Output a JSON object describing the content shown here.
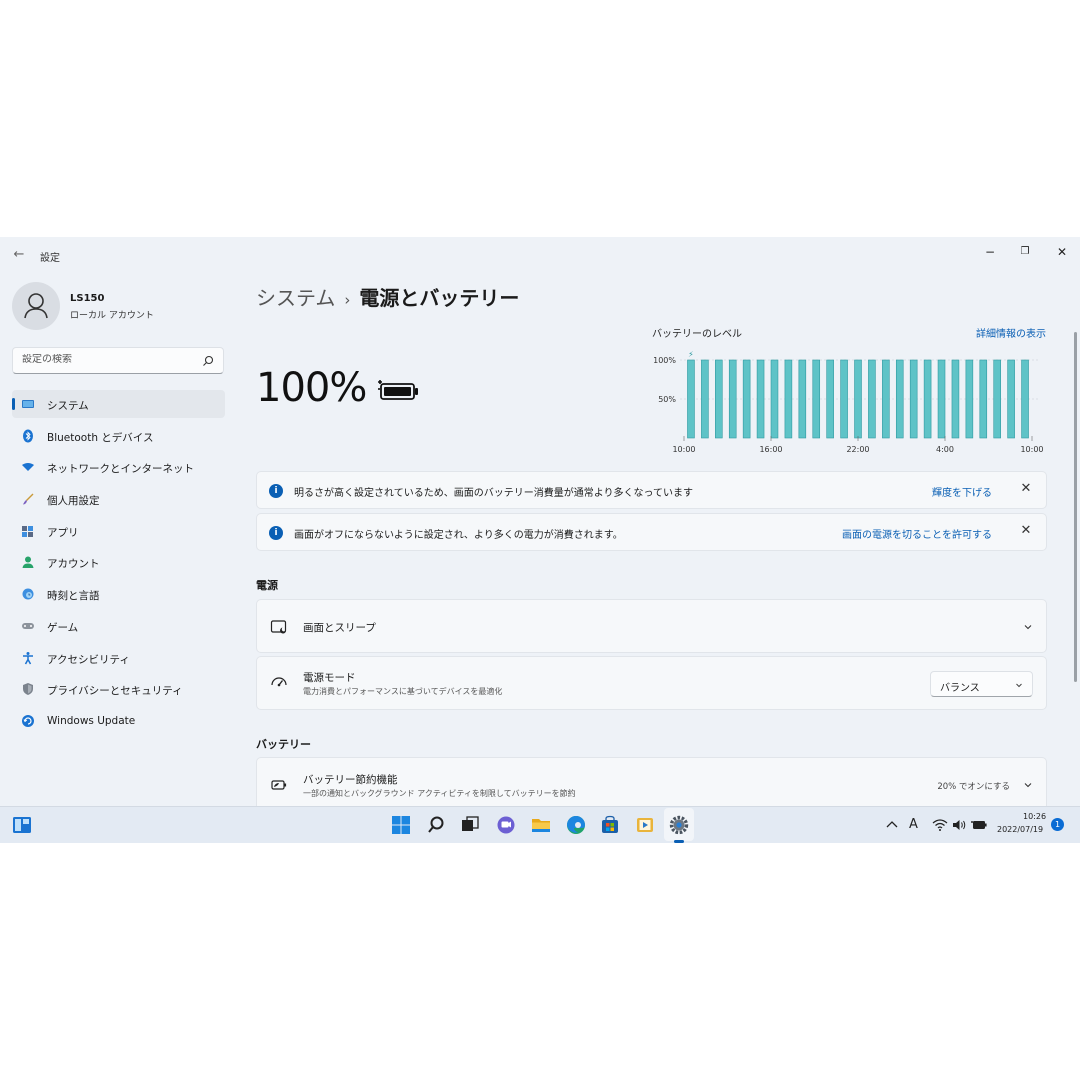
{
  "window": {
    "back_symbol": "←",
    "title": "設定",
    "minimize_symbol": "−",
    "restore_symbol": "❐",
    "close_symbol": "✕"
  },
  "profile": {
    "name": "LS150",
    "account_type": "ローカル アカウント"
  },
  "search": {
    "placeholder": "設定の検索"
  },
  "sidebar": {
    "items": [
      {
        "label": "システム",
        "icon": "system-icon",
        "active": true
      },
      {
        "label": "Bluetooth とデバイス",
        "icon": "bluetooth-icon"
      },
      {
        "label": "ネットワークとインターネット",
        "icon": "network-icon"
      },
      {
        "label": "個人用設定",
        "icon": "brush-icon"
      },
      {
        "label": "アプリ",
        "icon": "apps-icon"
      },
      {
        "label": "アカウント",
        "icon": "account-icon"
      },
      {
        "label": "時刻と言語",
        "icon": "globe-clock-icon"
      },
      {
        "label": "ゲーム",
        "icon": "gamepad-icon"
      },
      {
        "label": "アクセシビリティ",
        "icon": "accessibility-icon"
      },
      {
        "label": "プライバシーとセキュリティ",
        "icon": "shield-icon"
      },
      {
        "label": "Windows Update",
        "icon": "update-icon"
      }
    ]
  },
  "breadcrumb": {
    "parent": "システム",
    "separator": "›",
    "current": "電源とバッテリー"
  },
  "battery": {
    "percent_text": "100%",
    "level": 1.0
  },
  "chart_data": {
    "type": "bar",
    "title": "バッテリーのレベル",
    "link": "詳細情報の表示",
    "x_tick_labels": [
      "10:00",
      "16:00",
      "22:00",
      "4:00",
      "10:00"
    ],
    "y_tick_labels": [
      "100%",
      "50%"
    ],
    "ylim": [
      0,
      100
    ],
    "values": [
      100,
      100,
      100,
      100,
      100,
      100,
      100,
      100,
      100,
      100,
      100,
      100,
      100,
      100,
      100,
      100,
      100,
      100,
      100,
      100,
      100,
      100,
      100,
      100,
      100
    ],
    "charging_marker": "⚡",
    "colors": {
      "bar": "#5ec3c7",
      "bar_edge": "#2f9aa0",
      "grid": "#c7ccd2"
    }
  },
  "notices": [
    {
      "text": "明るさが高く設定されているため、画面のバッテリー消費量が通常より多くなっています",
      "action": "輝度を下げる"
    },
    {
      "text": "画面がオフにならないように設定され、より多くの電力が消費されます。",
      "action": "画面の電源を切ることを許可する"
    }
  ],
  "power_section": {
    "title": "電源",
    "screen_sleep": {
      "title": "画面とスリープ"
    },
    "power_mode": {
      "title": "電源モード",
      "subtitle": "電力消費とパフォーマンスに基づいてデバイスを最適化",
      "value": "バランス"
    }
  },
  "battery_section": {
    "title": "バッテリー",
    "saver": {
      "title": "バッテリー節約機能",
      "subtitle": "一部の通知とバックグラウンド アクティビティを制限してバッテリーを節約",
      "status": "20% でオンにする"
    }
  },
  "taskbar": {
    "ime": "A",
    "time": "10:26",
    "date": "2022/07/19",
    "notification_count": "1",
    "accent": "#0a5fb4"
  }
}
